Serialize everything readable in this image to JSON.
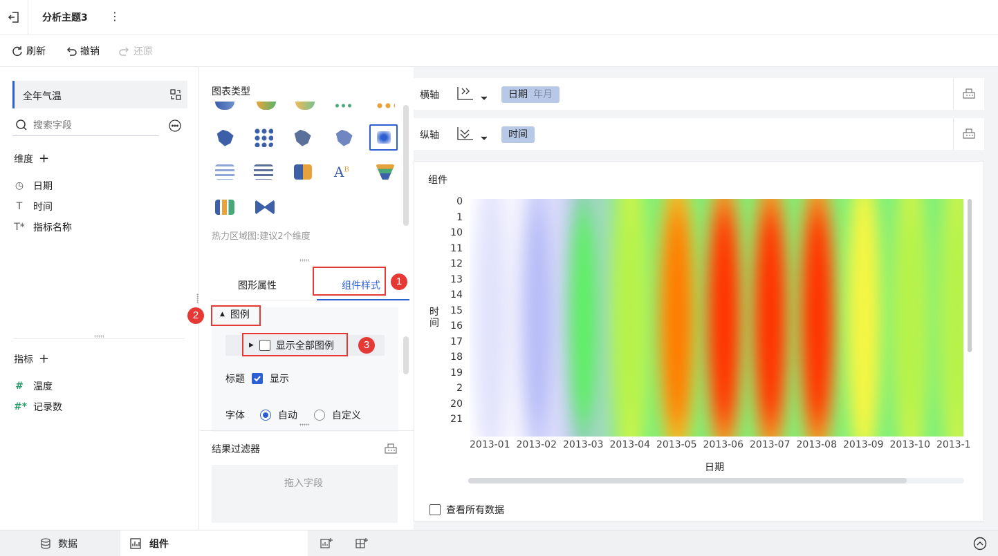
{
  "app": {
    "tab_title": "分析主题3",
    "more_icon": "⋮"
  },
  "toolbar": {
    "refresh_label": "刷新",
    "undo_label": "撤销",
    "redo_label": "还原"
  },
  "left_panel": {
    "dataset_name": "全年气温",
    "search_placeholder": "搜索字段",
    "dimensions_header": "维度",
    "dimensions": [
      {
        "icon": "clock-icon",
        "glyph": "◷",
        "label": "日期"
      },
      {
        "icon": "text-icon",
        "glyph": "T",
        "label": "时间"
      },
      {
        "icon": "text-star-icon",
        "glyph": "T*",
        "label": "指标名称"
      }
    ],
    "measures_header": "指标",
    "measures": [
      {
        "icon": "hash-icon",
        "glyph": "#",
        "label": "温度"
      },
      {
        "icon": "hash-star-icon",
        "glyph": "#*",
        "label": "记录数"
      }
    ]
  },
  "middle_panel": {
    "chart_type_title": "图表类型",
    "chart_type_hint": "热力区域图:建议2个维度",
    "tabs": [
      "图形属性",
      "组件样式"
    ],
    "legend_section": "图例",
    "show_all_legend": "显示全部图例",
    "title_label": "标题",
    "title_show": "显示",
    "font_label": "字体",
    "font_auto": "自动",
    "font_custom": "自定义",
    "filter_title": "结果过滤器",
    "filter_drop": "拖入字段",
    "annotations": [
      "1",
      "2",
      "3"
    ]
  },
  "axes": {
    "x_label": "横轴",
    "x_field": "日期",
    "x_field_sub": "年月",
    "y_label": "纵轴",
    "y_field": "时间"
  },
  "chart_card": {
    "title": "组件",
    "view_all": "查看所有数据"
  },
  "chart_data": {
    "type": "heatmap",
    "xlabel": "日期",
    "ylabel": "时间",
    "x_categories": [
      "2013-01",
      "2013-02",
      "2013-03",
      "2013-04",
      "2013-05",
      "2013-06",
      "2013-07",
      "2013-08",
      "2013-09",
      "2013-10",
      "2013-1"
    ],
    "y_categories": [
      "0",
      "1",
      "10",
      "11",
      "12",
      "13",
      "14",
      "15",
      "16",
      "17",
      "18",
      "19",
      "2",
      "20",
      "21"
    ],
    "intensity_by_month": [
      0.05,
      0.15,
      0.35,
      0.55,
      0.85,
      0.95,
      1.0,
      0.92,
      0.75,
      0.55,
      0.5
    ],
    "color_scale": [
      "#ffffff",
      "#b0b6f5",
      "#5df060",
      "#f7f542",
      "#ff3000"
    ]
  },
  "bottom_bar": {
    "data_tab": "数据",
    "component_tab": "组件"
  },
  "colors": {
    "accent": "#2d5fd3",
    "highlight": "#e53935",
    "pill": "#b8c9e8"
  }
}
